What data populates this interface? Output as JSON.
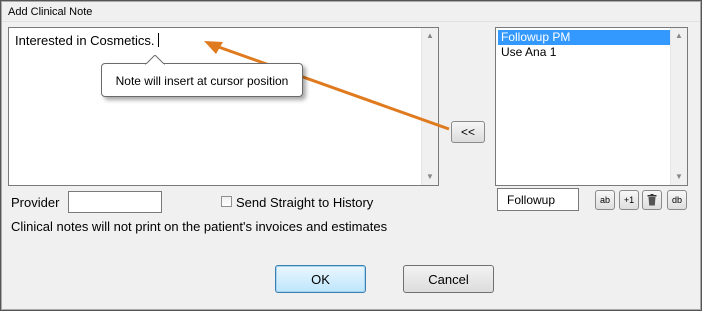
{
  "window": {
    "title": "Add Clinical Note"
  },
  "note": {
    "text": "Interested in Cosmetics."
  },
  "callout": {
    "text": "Note will insert at cursor position"
  },
  "insert_button": {
    "label": "<<"
  },
  "list": {
    "items": [
      {
        "label": "Followup PM",
        "selected": true
      },
      {
        "label": "Use Ana 1",
        "selected": false
      }
    ]
  },
  "provider": {
    "label": "Provider",
    "value": ""
  },
  "send_to_history": {
    "label": "Send Straight to History",
    "checked": false
  },
  "info_text": "Clinical notes will not print on the patient's invoices and estimates",
  "code_field": {
    "value": "Followup"
  },
  "tool_buttons": {
    "add": "ab",
    "plus1": "+1",
    "delete": "🗑",
    "db": "db"
  },
  "buttons": {
    "ok": "OK",
    "cancel": "Cancel"
  },
  "colors": {
    "annotation_arrow": "#e07a1f",
    "selection": "#3399ff"
  }
}
